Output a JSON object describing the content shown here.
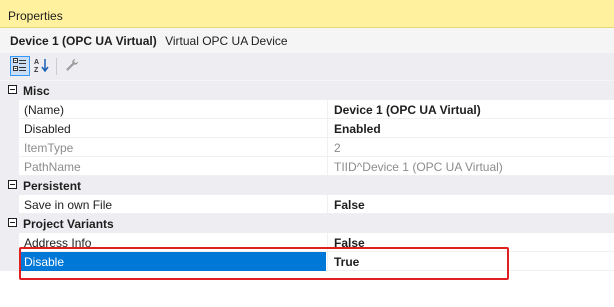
{
  "window": {
    "title": "Properties"
  },
  "object": {
    "name": "Device 1 (OPC UA Virtual)",
    "type": "Virtual OPC UA Device"
  },
  "toolbar": {
    "buttons": [
      {
        "icon": "categorized-icon",
        "active": true
      },
      {
        "icon": "alphabetical-sort-icon",
        "active": false
      },
      {
        "icon": "property-pages-wrench-icon",
        "active": false
      }
    ]
  },
  "grid": {
    "categories": [
      {
        "label": "Misc",
        "properties": [
          {
            "name": "(Name)",
            "value": "Device 1 (OPC UA Virtual)",
            "bold": true,
            "readonly": false
          },
          {
            "name": "Disabled",
            "value": "Enabled",
            "bold": true,
            "readonly": false
          },
          {
            "name": "ItemType",
            "value": "2",
            "bold": false,
            "readonly": true
          },
          {
            "name": "PathName",
            "value": "TIID^Device 1 (OPC UA Virtual)",
            "bold": false,
            "readonly": true
          }
        ]
      },
      {
        "label": "Persistent",
        "properties": [
          {
            "name": "Save in own File",
            "value": "False",
            "bold": true,
            "readonly": false
          }
        ]
      },
      {
        "label": "Project Variants",
        "properties": [
          {
            "name": "Address Info",
            "value": "False",
            "bold": true,
            "readonly": false
          },
          {
            "name": "Disable",
            "value": "True",
            "bold": true,
            "readonly": false,
            "selected": true
          }
        ]
      }
    ]
  },
  "colors": {
    "title_bar": "#fff19d",
    "selection": "#0078d7",
    "highlight_box": "#e02020"
  }
}
